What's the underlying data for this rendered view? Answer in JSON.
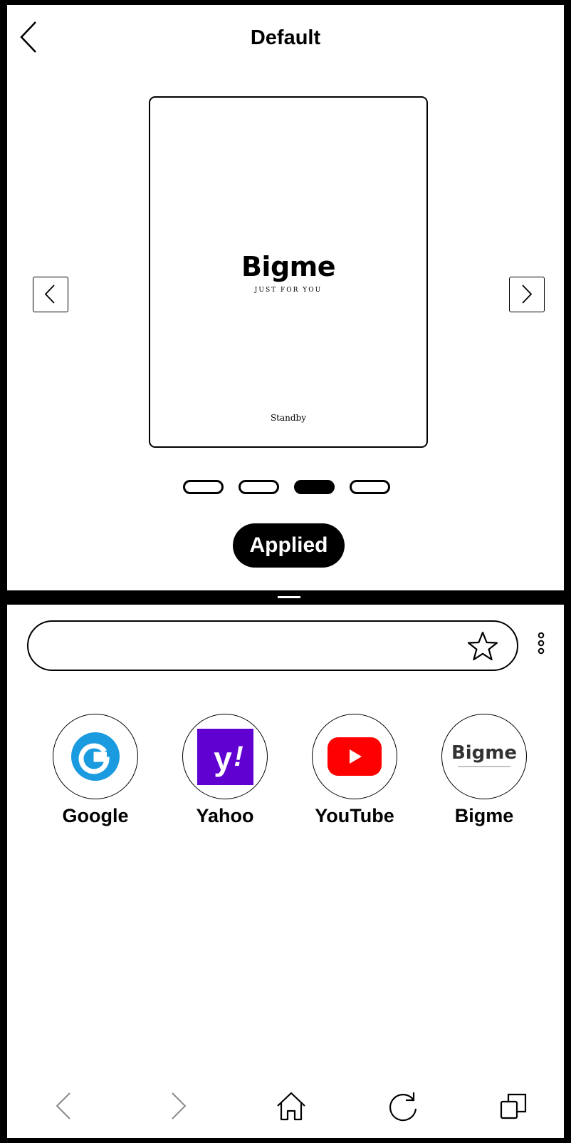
{
  "header": {
    "title": "Default"
  },
  "preview": {
    "brand": "Bigme",
    "tagline": "JUST FOR YOU",
    "status": "Standby"
  },
  "pager": {
    "count": 4,
    "active_index": 2
  },
  "apply_button": {
    "label": "Applied"
  },
  "browser": {
    "search": {
      "value": "",
      "placeholder": ""
    },
    "shortcuts": [
      {
        "label": "Google",
        "icon": "google-icon",
        "color": "#1a9be0"
      },
      {
        "label": "Yahoo",
        "icon": "yahoo-icon",
        "color": "#6001d2"
      },
      {
        "label": "YouTube",
        "icon": "youtube-icon",
        "color": "#ff0000"
      },
      {
        "label": "Bigme",
        "icon": "bigme-logo-icon",
        "color": "#333333"
      }
    ],
    "nav": [
      {
        "name": "back",
        "icon": "chevron-left-icon"
      },
      {
        "name": "forward",
        "icon": "chevron-right-icon"
      },
      {
        "name": "home",
        "icon": "home-icon"
      },
      {
        "name": "refresh",
        "icon": "refresh-icon"
      },
      {
        "name": "tabs",
        "icon": "tabs-icon"
      }
    ]
  }
}
